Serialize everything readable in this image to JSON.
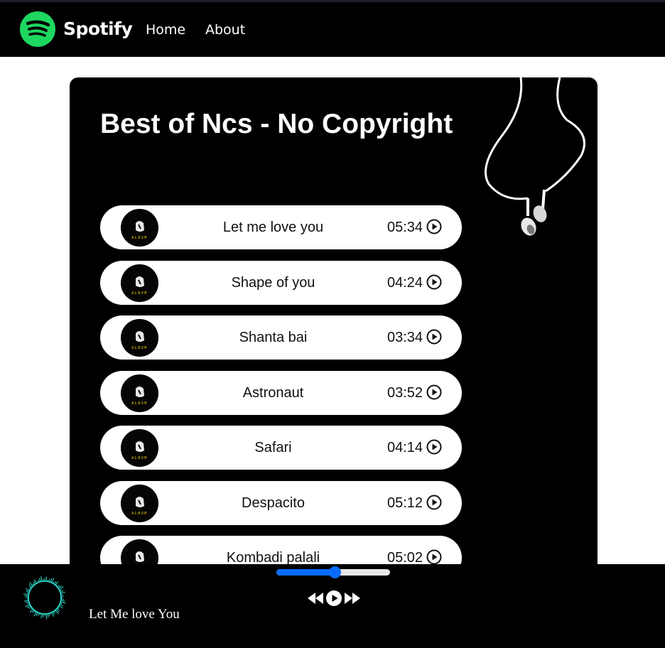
{
  "nav": {
    "brand": "Spotify",
    "links": [
      {
        "label": "Home"
      },
      {
        "label": "About"
      }
    ]
  },
  "playlist": {
    "title": "Best of Ncs - No Copyright",
    "songs": [
      {
        "name": "Let me love you",
        "duration": "05:34"
      },
      {
        "name": "Shape of you",
        "duration": "04:24"
      },
      {
        "name": "Shanta bai",
        "duration": "03:34"
      },
      {
        "name": "Astronaut",
        "duration": "03:52"
      },
      {
        "name": "Safari",
        "duration": "04:14"
      },
      {
        "name": "Despacito",
        "duration": "05:12"
      },
      {
        "name": "Kombadi palali",
        "duration": "05:02"
      }
    ]
  },
  "player": {
    "now_playing": "Let Me love You",
    "progress_fraction": 0.51
  },
  "colors": {
    "brand_green": "#1ed760",
    "accent_blue": "#0a6cff",
    "visualizer_cyan": "#2ee6d6"
  },
  "icons": {
    "logo": "spotify-logo-icon",
    "earphones": "earphones-icon",
    "song_thumb": "album-cover-icon",
    "play": "play-circle-icon",
    "prev": "backward-icon",
    "main_play": "play-circle-filled-icon",
    "next": "forward-icon",
    "visualizer": "audio-visualizer-icon"
  }
}
